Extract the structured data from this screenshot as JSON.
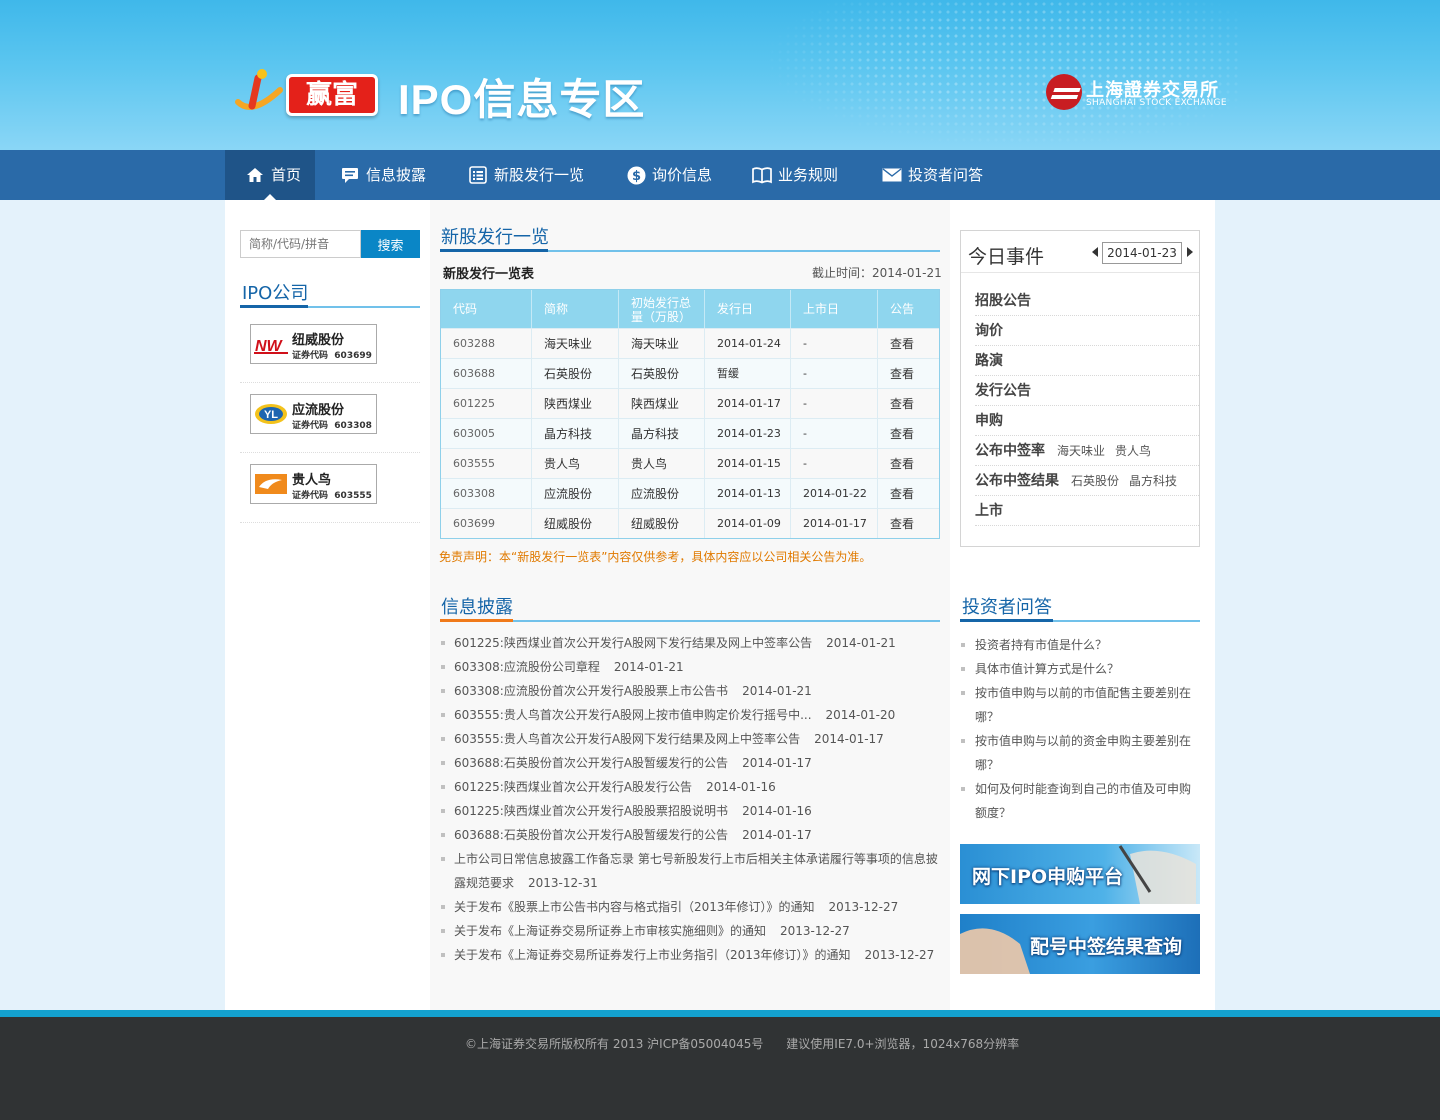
{
  "header": {
    "logo_text": "赢富",
    "zone_title": "IPO信息专区",
    "exchange_name_cn": "上海證券交易所",
    "exchange_name_en": "SHANGHAI STOCK EXCHANGE"
  },
  "nav": [
    {
      "label": "首页",
      "icon": "home-icon",
      "active": true
    },
    {
      "label": "信息披露",
      "icon": "comment-icon",
      "active": false
    },
    {
      "label": "新股发行一览",
      "icon": "list-icon",
      "active": false
    },
    {
      "label": "询价信息",
      "icon": "dollar-icon",
      "active": false
    },
    {
      "label": "业务规则",
      "icon": "book-icon",
      "active": false
    },
    {
      "label": "投资者问答",
      "icon": "mail-icon",
      "active": false
    }
  ],
  "search": {
    "placeholder": "简称/代码/拼音",
    "button": "搜索"
  },
  "ipo_companies": {
    "title": "IPO公司",
    "items": [
      {
        "name": "纽威股份",
        "code_label": "证券代码",
        "code": "603699"
      },
      {
        "name": "应流股份",
        "code_label": "证券代码",
        "code": "603308"
      },
      {
        "name": "贵人鸟",
        "code_label": "证券代码",
        "code": "603555"
      }
    ]
  },
  "new_issues": {
    "title": "新股发行一览",
    "subtitle": "新股发行一览表",
    "cutoff": "截止时间：2014-01-21",
    "columns": [
      "代码",
      "简称",
      "初始发行总量（万股）",
      "发行日",
      "上市日",
      "公告"
    ],
    "rows": [
      [
        "603288",
        "海天味业",
        "海天味业",
        "2014-01-24",
        "-",
        "查看"
      ],
      [
        "603688",
        "石英股份",
        "石英股份",
        "暂缓",
        "-",
        "查看"
      ],
      [
        "601225",
        "陕西煤业",
        "陕西煤业",
        "2014-01-17",
        "-",
        "查看"
      ],
      [
        "603005",
        "晶方科技",
        "晶方科技",
        "2014-01-23",
        "-",
        "查看"
      ],
      [
        "603555",
        "贵人鸟",
        "贵人鸟",
        "2014-01-15",
        "-",
        "查看"
      ],
      [
        "603308",
        "应流股份",
        "应流股份",
        "2014-01-13",
        "2014-01-22",
        "查看"
      ],
      [
        "603699",
        "纽威股份",
        "纽威股份",
        "2014-01-09",
        "2014-01-17",
        "查看"
      ]
    ],
    "disclaimer": "免责声明：本“新股发行一览表”内容仅供参考，具体内容应以公司相关公告为准。"
  },
  "disclosure": {
    "title": "信息披露",
    "items": [
      {
        "text": "601225:陕西煤业首次公开发行A股网下发行结果及网上中签率公告",
        "date": "2014-01-21"
      },
      {
        "text": "603308:应流股份公司章程",
        "date": "2014-01-21"
      },
      {
        "text": "603308:应流股份首次公开发行A股股票上市公告书",
        "date": "2014-01-21"
      },
      {
        "text": "603555:贵人鸟首次公开发行A股网上按市值申购定价发行摇号中...",
        "date": "2014-01-20"
      },
      {
        "text": "603555:贵人鸟首次公开发行A股网下发行结果及网上中签率公告",
        "date": "2014-01-17"
      },
      {
        "text": "603688:石英股份首次公开发行A股暂缓发行的公告",
        "date": "2014-01-17"
      },
      {
        "text": "601225:陕西煤业首次公开发行A股发行公告",
        "date": "2014-01-16"
      },
      {
        "text": "601225:陕西煤业首次公开发行A股股票招股说明书",
        "date": "2014-01-16"
      },
      {
        "text": "603688:石英股份首次公开发行A股暂缓发行的公告",
        "date": "2014-01-17"
      },
      {
        "text": "上市公司日常信息披露工作备忘录 第七号新股发行上市后相关主体承诺履行等事项的信息披露规范要求",
        "date": "2013-12-31"
      },
      {
        "text": "关于发布《股票上市公告书内容与格式指引（2013年修订）》的通知",
        "date": "2013-12-27"
      },
      {
        "text": "关于发布《上海证券交易所证券上市审核实施细则》的通知",
        "date": "2013-12-27"
      },
      {
        "text": "关于发布《上海证券交易所证券发行上市业务指引（2013年修订）》的通知",
        "date": "2013-12-27"
      }
    ]
  },
  "today": {
    "title": "今日事件",
    "date": "2014-01-23",
    "events": [
      {
        "label": "招股公告",
        "tags": []
      },
      {
        "label": "询价",
        "tags": []
      },
      {
        "label": "路演",
        "tags": []
      },
      {
        "label": "发行公告",
        "tags": []
      },
      {
        "label": "申购",
        "tags": []
      },
      {
        "label": "公布中签率",
        "tags": [
          "海天味业",
          "贵人鸟"
        ]
      },
      {
        "label": "公布中签结果",
        "tags": [
          "石英股份",
          "晶方科技"
        ]
      },
      {
        "label": "上市",
        "tags": []
      }
    ]
  },
  "faq": {
    "title": "投资者问答",
    "items": [
      "投资者持有市值是什么？",
      "具体市值计算方式是什么？",
      "按市值申购与以前的市值配售主要差别在哪？",
      "按市值申购与以前的资金申购主要差别在哪？",
      "如何及何时能查询到自己的市值及可申购额度？"
    ]
  },
  "banners": [
    "网下IPO申购平台",
    "配号中签结果查询"
  ],
  "footer": {
    "copyright": "©上海证券交易所版权所有 2013 沪ICP备05004045号",
    "browser_note": "建议使用IE7.0+浏览器，1024x768分辨率"
  },
  "colors": {
    "nav_bg": "#2a6aa8",
    "accent_blue": "#1565a8",
    "accent_orange": "#f07a1a",
    "footer_bg": "#303334",
    "table_header": "#8fd6ee"
  }
}
